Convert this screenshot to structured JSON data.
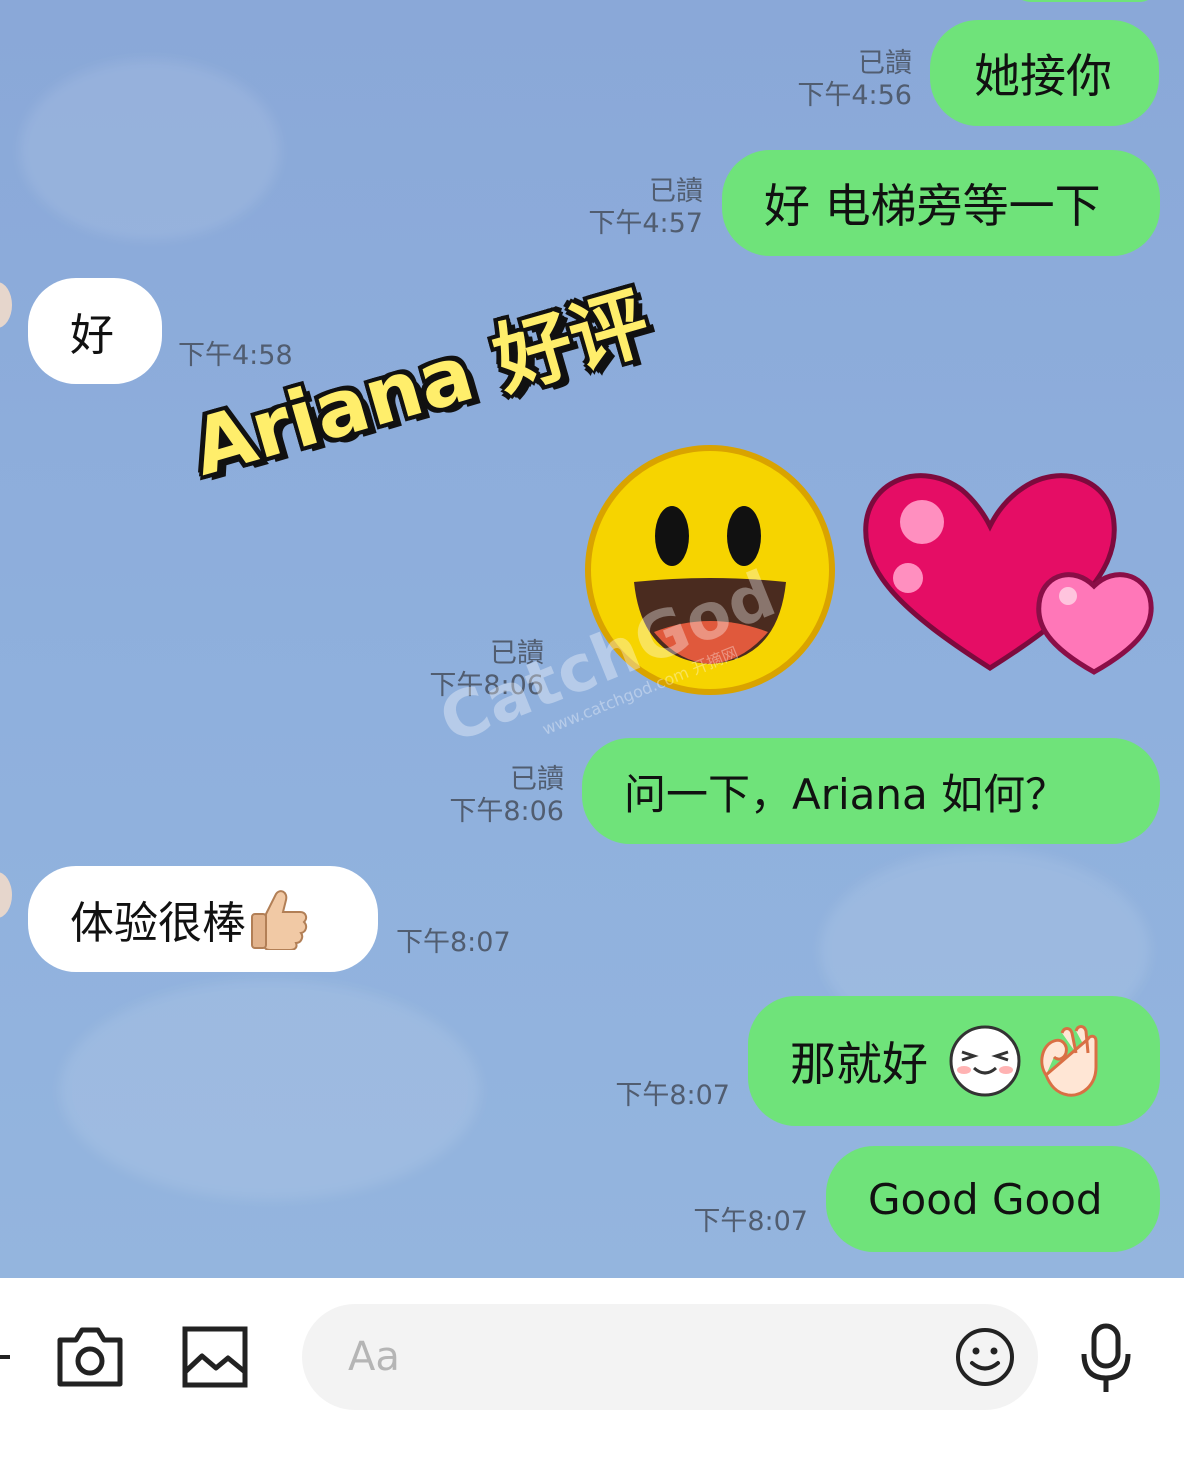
{
  "chat": {
    "messages": [
      {
        "side": "out",
        "text": "她接你",
        "read": "已讀",
        "time": "下午4:56"
      },
      {
        "side": "out",
        "text": "好 电梯旁等一下",
        "read": "已讀",
        "time": "下午4:57"
      },
      {
        "side": "in",
        "text": "好",
        "time": "下午4:58"
      },
      {
        "side": "out",
        "type": "sticker",
        "sticker_icons": [
          "grinning-face-icon",
          "two-hearts-icon"
        ],
        "read": "已讀",
        "time": "下午8:06"
      },
      {
        "side": "out",
        "text": "问一下，Ariana 如何？",
        "read": "已讀",
        "time": "下午8:06"
      },
      {
        "side": "in",
        "text": "体验很棒",
        "emoji": "thumbs-up-icon",
        "time": "下午8:07"
      },
      {
        "side": "out",
        "text": "那就好",
        "emoji": [
          "squinting-face-icon",
          "ok-hand-icon"
        ],
        "time": "下午8:07"
      },
      {
        "side": "out",
        "text": "Good Good",
        "time": "下午8:07"
      }
    ]
  },
  "overlay": {
    "caption": "Ariana 好评",
    "watermark": "CatchGod",
    "watermark_sub": "www.catchgod.com 开摘网"
  },
  "input_bar": {
    "placeholder": "Aa",
    "icons": [
      "plus-icon",
      "camera-icon",
      "image-icon",
      "emoji-icon",
      "microphone-icon"
    ]
  },
  "colors": {
    "chat_background": "#8aa8d8",
    "outgoing_bubble": "#6fe37a",
    "incoming_bubble": "#ffffff",
    "caption_text": "#ffee6b",
    "meta_text": "#515d70"
  }
}
